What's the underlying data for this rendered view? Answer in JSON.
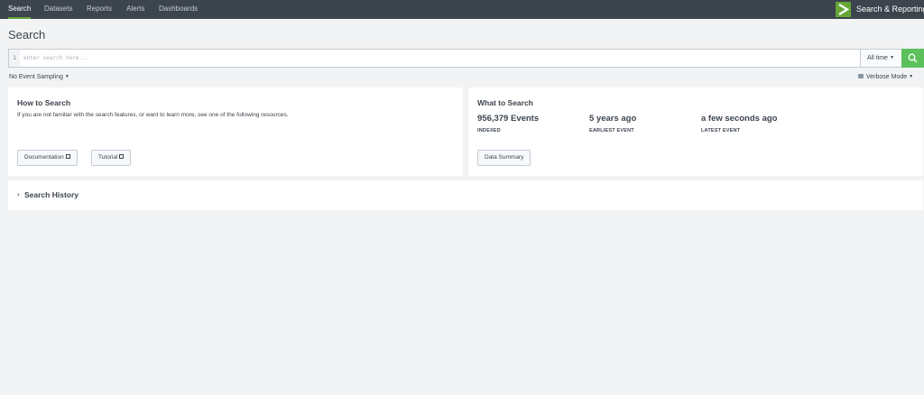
{
  "nav": {
    "tabs": [
      {
        "label": "Search",
        "active": true
      },
      {
        "label": "Datasets",
        "active": false
      },
      {
        "label": "Reports",
        "active": false
      },
      {
        "label": "Alerts",
        "active": false
      },
      {
        "label": "Dashboards",
        "active": false
      }
    ],
    "app_name": "Search & Reporting",
    "app_icon": "greater-than-icon"
  },
  "page": {
    "title": "Search"
  },
  "search": {
    "line_number": "1",
    "placeholder": "enter search here...",
    "value": "",
    "time_range": "All time",
    "search_icon": "search-icon"
  },
  "options": {
    "sampling": "No Event Sampling",
    "mode": "Verbose Mode"
  },
  "how_to": {
    "title": "How to Search",
    "text": "If you are not familiar with the search features, or want to learn more, see one of the following resources.",
    "buttons": [
      "Documentation",
      "Tutorial"
    ]
  },
  "what_to": {
    "title": "What to Search",
    "stats": [
      {
        "value": "956,379 Events",
        "label": "INDEXED"
      },
      {
        "value": "5 years ago",
        "label": "EARLIEST EVENT"
      },
      {
        "value": "a few seconds ago",
        "label": "LATEST EVENT"
      }
    ],
    "button": "Data Summary"
  },
  "history": {
    "label": "Search History"
  },
  "colors": {
    "nav_bg": "#3c444d",
    "accent": "#65a637",
    "search_button": "#5cc05c",
    "page_bg": "#f2f3f4"
  }
}
